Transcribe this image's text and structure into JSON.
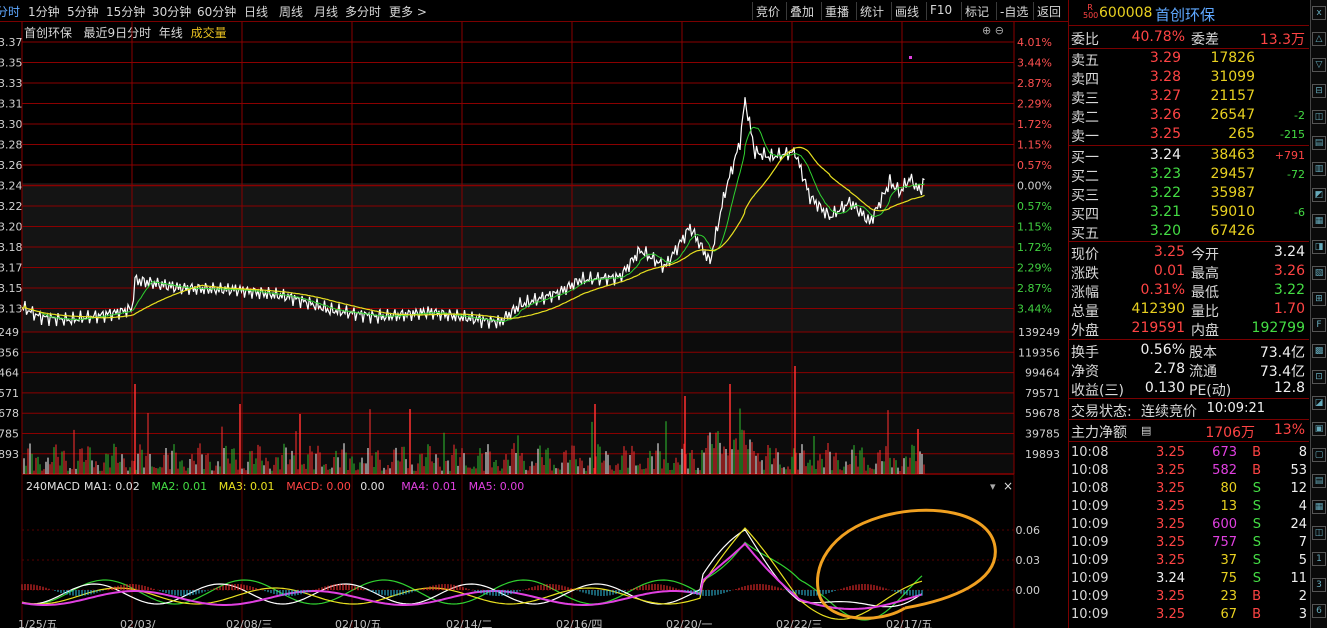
{
  "toolbar": {
    "first": "分时",
    "items": [
      "1分钟",
      "5分钟",
      "15分钟",
      "30分钟",
      "60分钟",
      "日线",
      "周线",
      "月线",
      "多分时",
      "更多 >"
    ],
    "right": [
      "竞价",
      "叠加",
      "重播",
      "统计",
      "画线",
      "F10",
      "标记",
      "-自选",
      "返回"
    ]
  },
  "chart_header": {
    "name": "首创环保",
    "period": "最近9日分时",
    "mode": "年线",
    "volume": "成交量"
  },
  "price_axis": {
    "left": [
      "3.37",
      "3.35",
      "3.33",
      "3.31",
      "3.30",
      "3.28",
      "3.26",
      "3.24",
      "3.22",
      "3.20",
      "3.18",
      "3.17",
      "3.15",
      "3.13"
    ],
    "right": [
      "4.01%",
      "3.44%",
      "2.87%",
      "2.29%",
      "1.72%",
      "1.15%",
      "0.57%",
      "0.00%",
      "0.57%",
      "1.15%",
      "1.72%",
      "2.29%",
      "2.87%",
      "3.44%"
    ]
  },
  "volume_axis": {
    "left": [
      "249",
      "356",
      "464",
      "571",
      "678",
      "785",
      "893"
    ],
    "right": [
      "139249",
      "119356",
      "99464",
      "79571",
      "59678",
      "39785",
      "19893"
    ]
  },
  "macd": {
    "title": "240MACD",
    "items": [
      {
        "label": "MA1:",
        "value": "0.02",
        "color": "#e0e0e0"
      },
      {
        "label": "MA2:",
        "value": "0.01",
        "color": "#44dd44"
      },
      {
        "label": "MA3:",
        "value": "0.01",
        "color": "#e8e020"
      },
      {
        "label": "MACD:",
        "value": "0.00",
        "color": "#ff4444"
      },
      {
        "label": "",
        "value": "0.00",
        "color": "#e0e0e0"
      },
      {
        "label": "MA4:",
        "value": "0.01",
        "color": "#e040e0"
      },
      {
        "label": "MA5:",
        "value": "0.00",
        "color": "#e040e0"
      }
    ],
    "axis": [
      "0.06",
      "0.03",
      "0.00"
    ]
  },
  "date_axis": [
    "1/25/五",
    "02/03/",
    "02/08/三",
    "02/10/五",
    "02/14/二",
    "02/16/四",
    "02/20/一",
    "02/22/三",
    "02/17/五"
  ],
  "panel": {
    "code": "600008",
    "name": "首创环保",
    "badge_top": "R",
    "badge_bottom": "500",
    "weibi_label": "委比",
    "weibi": "40.78%",
    "weicha_label": "委差",
    "weicha": "13.3万",
    "asks": [
      {
        "label": "卖五",
        "price": "3.29",
        "vol": "17826",
        "chg": ""
      },
      {
        "label": "卖四",
        "price": "3.28",
        "vol": "31099",
        "chg": ""
      },
      {
        "label": "卖三",
        "price": "3.27",
        "vol": "21157",
        "chg": ""
      },
      {
        "label": "卖二",
        "price": "3.26",
        "vol": "26547",
        "chg": "-2"
      },
      {
        "label": "卖一",
        "price": "3.25",
        "vol": "265",
        "chg": "-215"
      }
    ],
    "bids": [
      {
        "label": "买一",
        "price": "3.24",
        "vol": "38463",
        "chg": "+791"
      },
      {
        "label": "买二",
        "price": "3.23",
        "vol": "29457",
        "chg": "-72"
      },
      {
        "label": "买三",
        "price": "3.22",
        "vol": "35987",
        "chg": ""
      },
      {
        "label": "买四",
        "price": "3.21",
        "vol": "59010",
        "chg": "-6"
      },
      {
        "label": "买五",
        "price": "3.20",
        "vol": "67426",
        "chg": ""
      }
    ],
    "stats": [
      {
        "l1": "现价",
        "v1": "3.25",
        "c1": "red",
        "l2": "今开",
        "v2": "3.24",
        "c2": "white"
      },
      {
        "l1": "涨跌",
        "v1": "0.01",
        "c1": "red",
        "l2": "最高",
        "v2": "3.26",
        "c2": "red"
      },
      {
        "l1": "涨幅",
        "v1": "0.31%",
        "c1": "red",
        "l2": "最低",
        "v2": "3.22",
        "c2": "green"
      },
      {
        "l1": "总量",
        "v1": "412390",
        "c1": "yellow",
        "l2": "量比",
        "v2": "1.70",
        "c2": "red"
      },
      {
        "l1": "外盘",
        "v1": "219591",
        "c1": "red",
        "l2": "内盘",
        "v2": "192799",
        "c2": "green"
      }
    ],
    "stats2": [
      {
        "l1": "换手",
        "v1": "0.56%",
        "l2": "股本",
        "v2": "73.4亿"
      },
      {
        "l1": "净资",
        "v1": "2.78",
        "l2": "流通",
        "v2": "73.4亿"
      },
      {
        "l1": "收益(三)",
        "v1": "0.130",
        "l2": "PE(动)",
        "v2": "12.8"
      }
    ],
    "status_label": "交易状态:",
    "status": "连续竞价",
    "status_time": "10:09:21",
    "main_flow_label": "主力净额",
    "main_flow": "1706万",
    "main_flow_pct": "13%",
    "trades": [
      {
        "t": "10:08",
        "p": "3.25",
        "v": "673",
        "d": "B",
        "n": "8"
      },
      {
        "t": "10:08",
        "p": "3.25",
        "v": "582",
        "d": "B",
        "n": "53"
      },
      {
        "t": "10:08",
        "p": "3.25",
        "v": "80",
        "d": "S",
        "n": "12"
      },
      {
        "t": "10:09",
        "p": "3.25",
        "v": "13",
        "d": "S",
        "n": "4"
      },
      {
        "t": "10:09",
        "p": "3.25",
        "v": "600",
        "d": "S",
        "n": "24"
      },
      {
        "t": "10:09",
        "p": "3.25",
        "v": "757",
        "d": "S",
        "n": "7"
      },
      {
        "t": "10:09",
        "p": "3.25",
        "v": "37",
        "d": "S",
        "n": "5"
      },
      {
        "t": "10:09",
        "p": "3.24",
        "v": "75",
        "d": "S",
        "n": "11"
      },
      {
        "t": "10:09",
        "p": "3.25",
        "v": "23",
        "d": "B",
        "n": "2"
      },
      {
        "t": "10:09",
        "p": "3.25",
        "v": "67",
        "d": "B",
        "n": "3"
      }
    ]
  }
}
